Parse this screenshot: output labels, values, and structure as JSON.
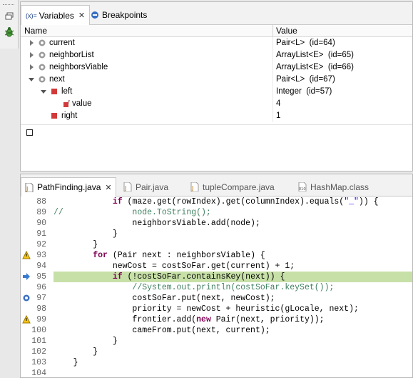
{
  "variables_view": {
    "tabs": [
      {
        "label": "Variables",
        "prefix": "(x)=",
        "active": true
      },
      {
        "label": "Breakpoints",
        "active": false
      }
    ],
    "columns": [
      "Name",
      "Value"
    ],
    "rows": [
      {
        "name": "current",
        "value": "Pair<L>  (id=64)",
        "depth": 0,
        "twisty": "collapsed"
      },
      {
        "name": "neighborList",
        "value": "ArrayList<E>  (id=65)",
        "depth": 0,
        "twisty": "collapsed"
      },
      {
        "name": "neighborsViable",
        "value": "ArrayList<E>  (id=66)",
        "depth": 0,
        "twisty": "collapsed"
      },
      {
        "name": "next",
        "value": "Pair<L>  (id=67)",
        "depth": 0,
        "twisty": "expanded"
      },
      {
        "name": "left",
        "value": "Integer  (id=57)",
        "depth": 1,
        "twisty": "expanded"
      },
      {
        "name": "value",
        "value": "4",
        "depth": 2,
        "twisty": "none"
      },
      {
        "name": "right",
        "value": "1",
        "depth": 1,
        "twisty": "none"
      }
    ],
    "detail_text": "[]"
  },
  "editor": {
    "tabs": [
      {
        "label": "PathFinding.java",
        "active": true
      },
      {
        "label": "Pair.java",
        "active": false
      },
      {
        "label": "tupleCompare.java",
        "active": false
      },
      {
        "label": "HashMap.class",
        "active": false
      }
    ],
    "lines": [
      {
        "num": "88",
        "text": "            if (maze.get(rowIndex).get(columnIndex).equals(\"_\")) {"
      },
      {
        "num": "89",
        "text": "//              node.ToString();"
      },
      {
        "num": "90",
        "text": "                neighborsViable.add(node);"
      },
      {
        "num": "91",
        "text": "            }"
      },
      {
        "num": "92",
        "text": "        }"
      },
      {
        "num": "93",
        "text": "        for (Pair next : neighborsViable) {"
      },
      {
        "num": "94",
        "text": "            newCost = costSoFar.get(current) + 1;"
      },
      {
        "num": "95",
        "text": "            if (!costSoFar.containsKey(next)) {"
      },
      {
        "num": "96",
        "text": "                //System.out.println(costSoFar.keySet());"
      },
      {
        "num": "97",
        "text": "                costSoFar.put(next, newCost);"
      },
      {
        "num": "98",
        "text": "                priority = newCost + heuristic(gLocale, next);"
      },
      {
        "num": "99",
        "text": "                frontier.add(new Pair(next, priority));"
      },
      {
        "num": "100",
        "text": "                cameFrom.put(next, current);"
      },
      {
        "num": "101",
        "text": "            }"
      },
      {
        "num": "102",
        "text": "        }"
      },
      {
        "num": "103",
        "text": "    }"
      },
      {
        "num": "104",
        "text": ""
      }
    ],
    "highlighted_line": "95"
  },
  "colors": {
    "highlight": "#c7e0a8",
    "keyword": "#7f0055",
    "comment": "#3f7f5f",
    "string": "#2a00ff"
  }
}
